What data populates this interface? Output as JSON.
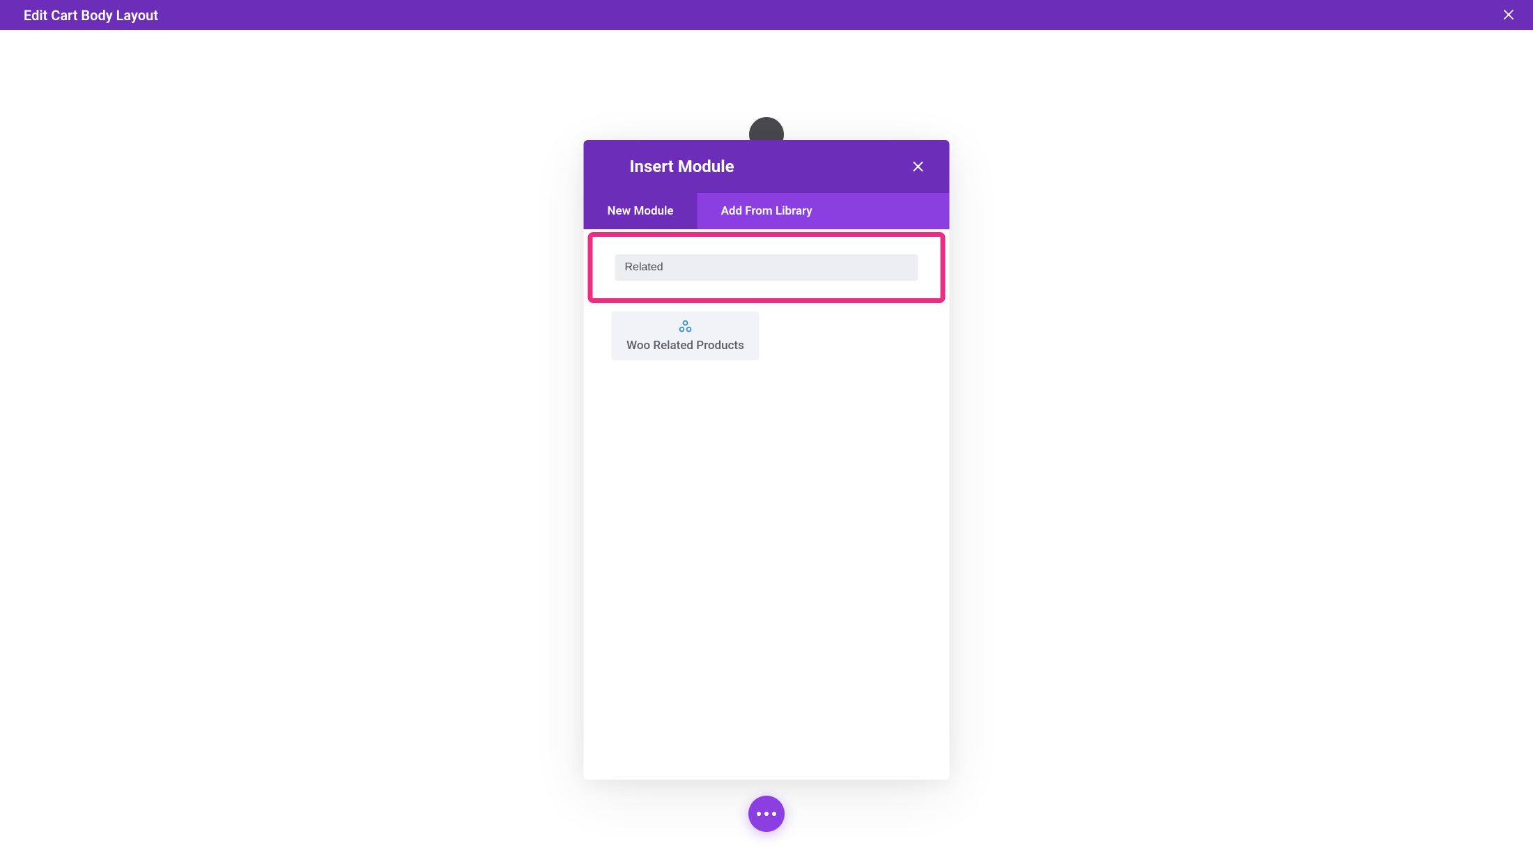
{
  "topbar": {
    "title": "Edit Cart Body Layout"
  },
  "modal": {
    "title": "Insert Module",
    "tabs": {
      "new_module": "New Module",
      "add_from_library": "Add From Library"
    },
    "search": {
      "value": "Related"
    },
    "results": [
      {
        "label": "Woo Related Products"
      }
    ]
  }
}
